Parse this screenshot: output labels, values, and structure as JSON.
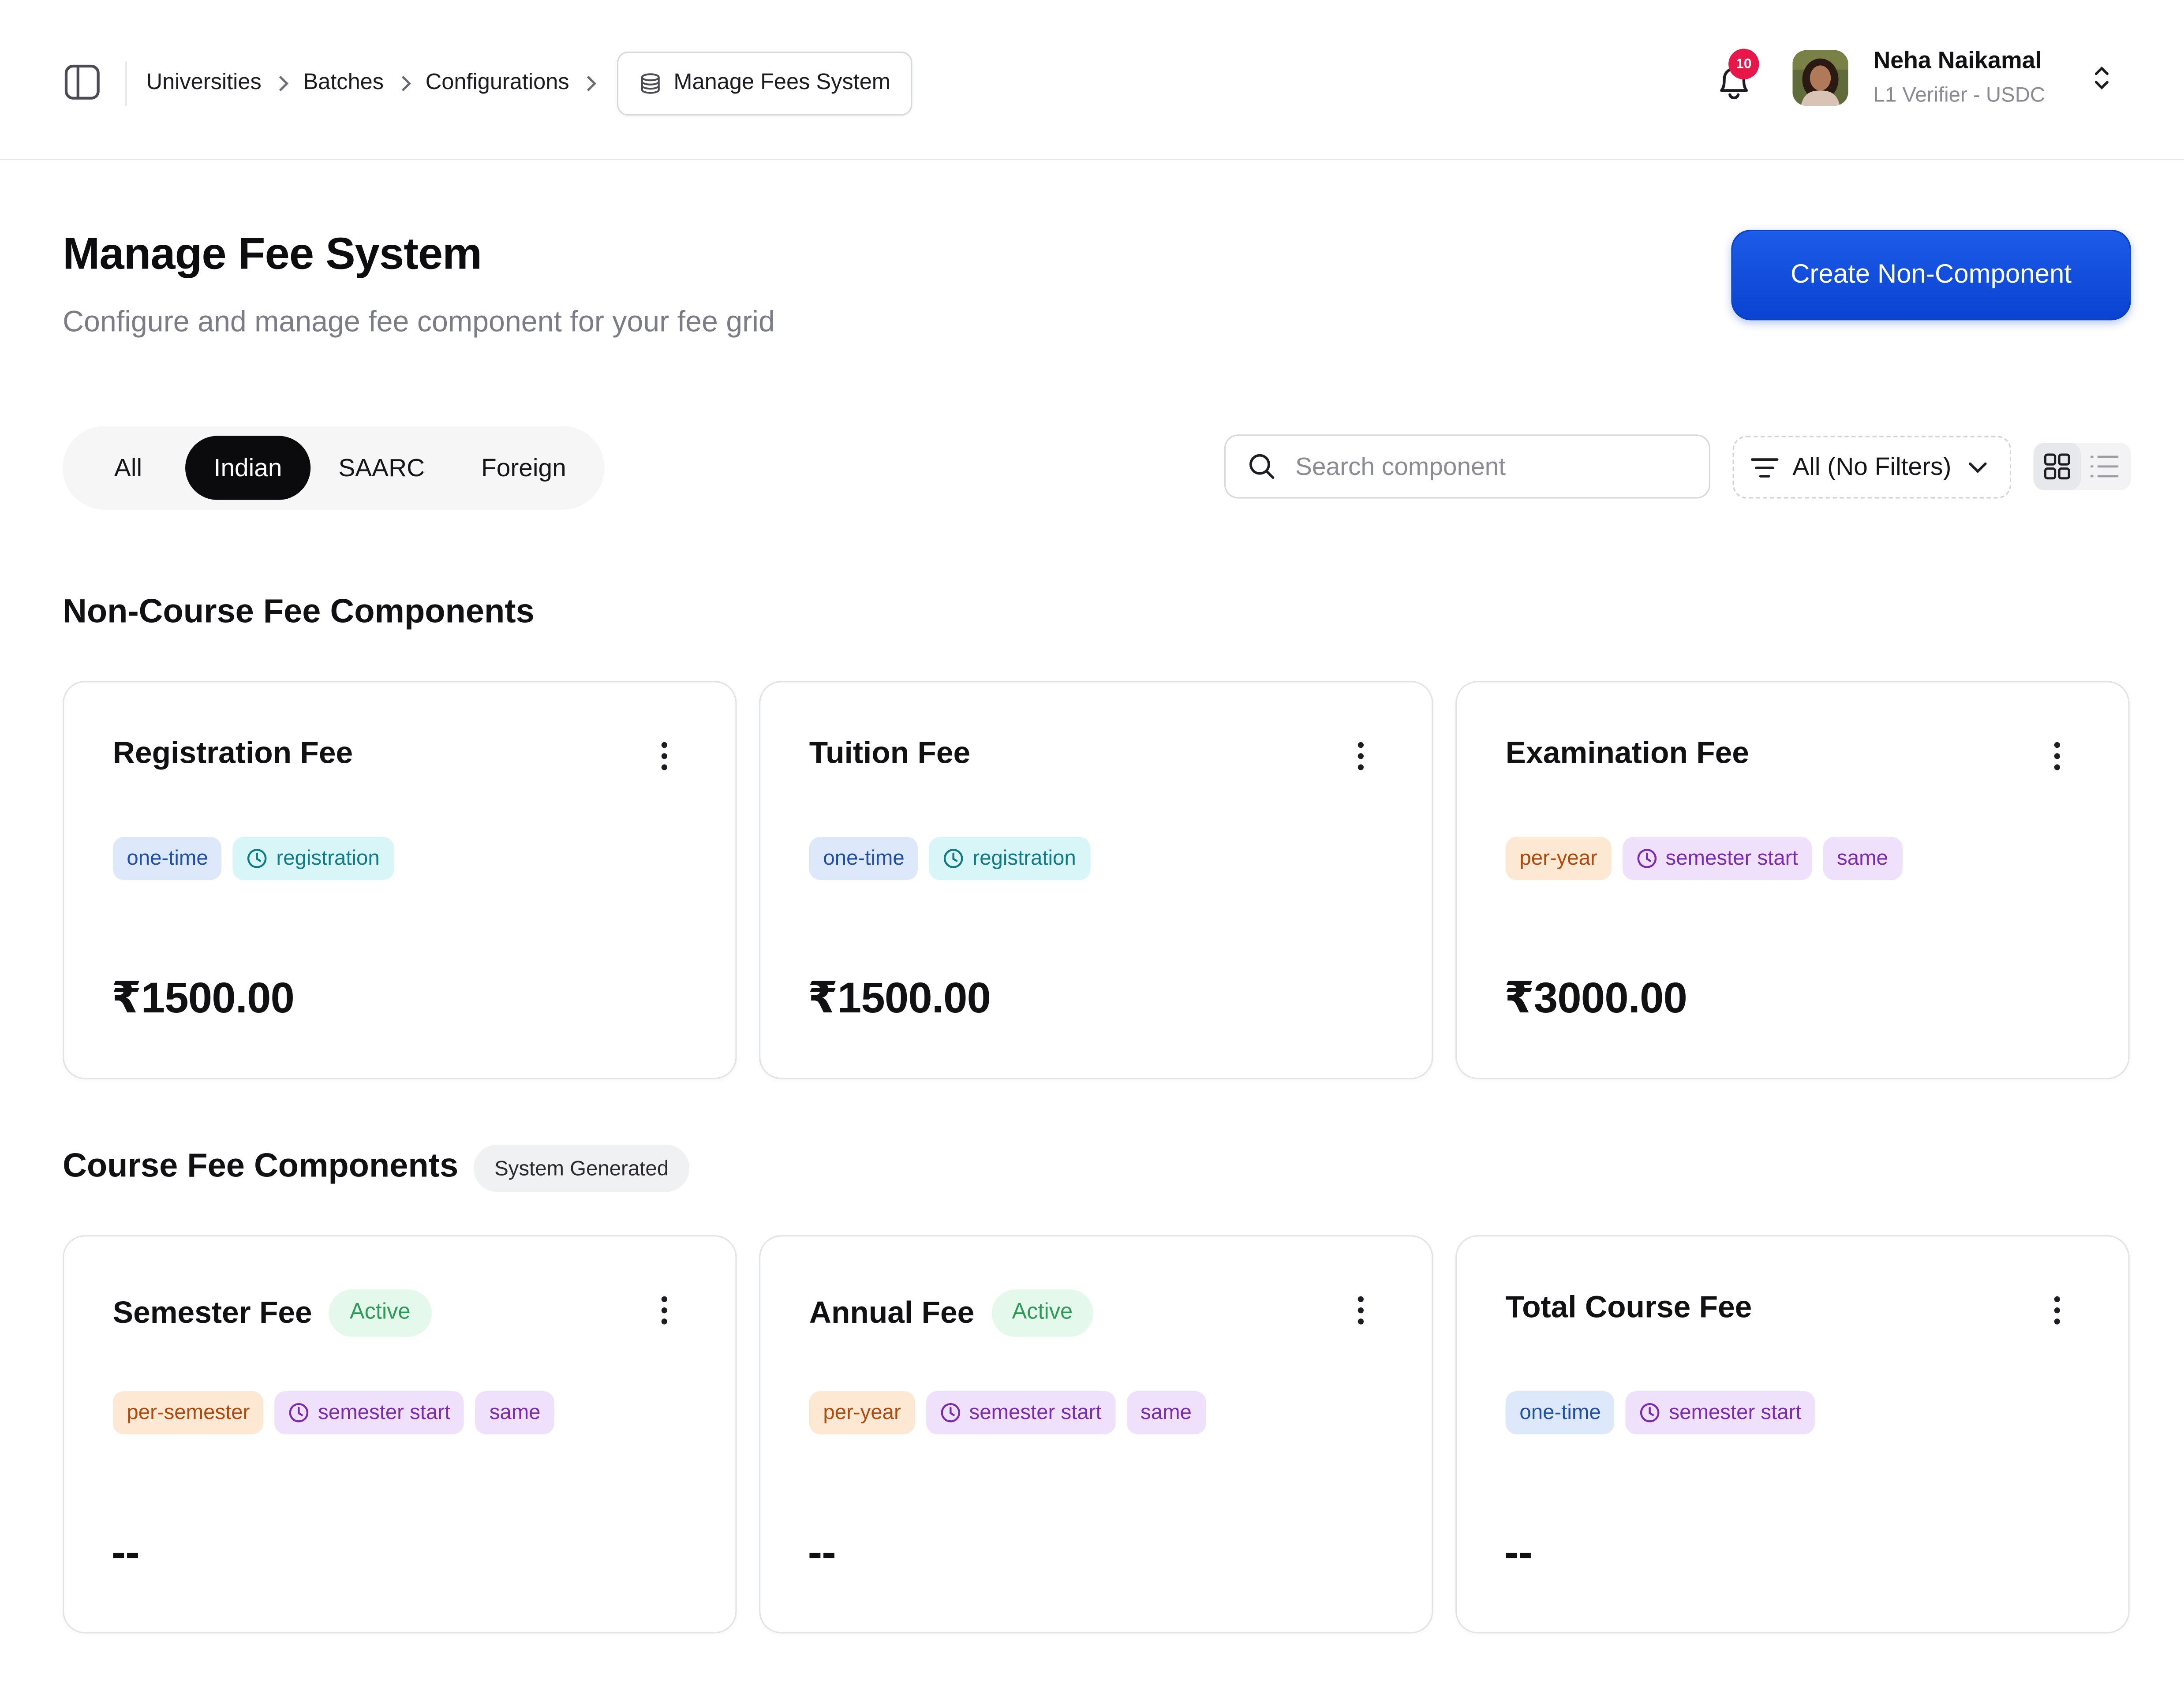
{
  "breadcrumb": {
    "items": [
      "Universities",
      "Batches",
      "Configurations"
    ],
    "current": "Manage Fees System"
  },
  "notifications": {
    "count": "10"
  },
  "user": {
    "name": "Neha Naikamal",
    "role": "L1 Verifier - USDC"
  },
  "page": {
    "title": "Manage Fee System",
    "subtitle": "Configure and manage fee component for your fee grid",
    "create_button": "Create Non-Component"
  },
  "tabs": [
    {
      "label": "All",
      "active": false
    },
    {
      "label": "Indian",
      "active": true
    },
    {
      "label": "SAARC",
      "active": false
    },
    {
      "label": "Foreign",
      "active": false
    }
  ],
  "search": {
    "placeholder": "Search component",
    "value": ""
  },
  "filter": {
    "label": "All (No Filters)"
  },
  "view": {
    "selected": "grid"
  },
  "non_course": {
    "title": "Non-Course Fee Components",
    "cards": [
      {
        "title": "Registration Fee",
        "tags": [
          {
            "text": "one-time",
            "color": "blue",
            "icon": false
          },
          {
            "text": "registration",
            "color": "cyan",
            "icon": true
          }
        ],
        "amount": "₹1500.00"
      },
      {
        "title": "Tuition Fee",
        "tags": [
          {
            "text": "one-time",
            "color": "blue",
            "icon": false
          },
          {
            "text": "registration",
            "color": "cyan",
            "icon": true
          }
        ],
        "amount": "₹1500.00"
      },
      {
        "title": "Examination Fee",
        "tags": [
          {
            "text": "per-year",
            "color": "orange",
            "icon": false
          },
          {
            "text": "semester start",
            "color": "purple",
            "icon": true
          },
          {
            "text": "same",
            "color": "purple",
            "icon": false
          }
        ],
        "amount": "₹3000.00"
      }
    ]
  },
  "course": {
    "title": "Course Fee Components",
    "badge": "System Generated",
    "cards": [
      {
        "title": "Semester Fee",
        "status": "Active",
        "tags": [
          {
            "text": "per-semester",
            "color": "orange",
            "icon": false
          },
          {
            "text": "semester start",
            "color": "purple",
            "icon": true
          },
          {
            "text": "same",
            "color": "purple",
            "icon": false
          }
        ],
        "amount": "--"
      },
      {
        "title": "Annual Fee",
        "status": "Active",
        "tags": [
          {
            "text": "per-year",
            "color": "orange",
            "icon": false
          },
          {
            "text": "semester start",
            "color": "purple",
            "icon": true
          },
          {
            "text": "same",
            "color": "purple",
            "icon": false
          }
        ],
        "amount": "--"
      },
      {
        "title": "Total Course Fee",
        "status": "",
        "tags": [
          {
            "text": "one-time",
            "color": "blue",
            "icon": false
          },
          {
            "text": "semester start",
            "color": "purple",
            "icon": true
          }
        ],
        "amount": "--"
      }
    ]
  },
  "colors": {
    "primary": "#0a43d1",
    "badge": "#e8174a",
    "active_tab": "#0b0b0d"
  }
}
